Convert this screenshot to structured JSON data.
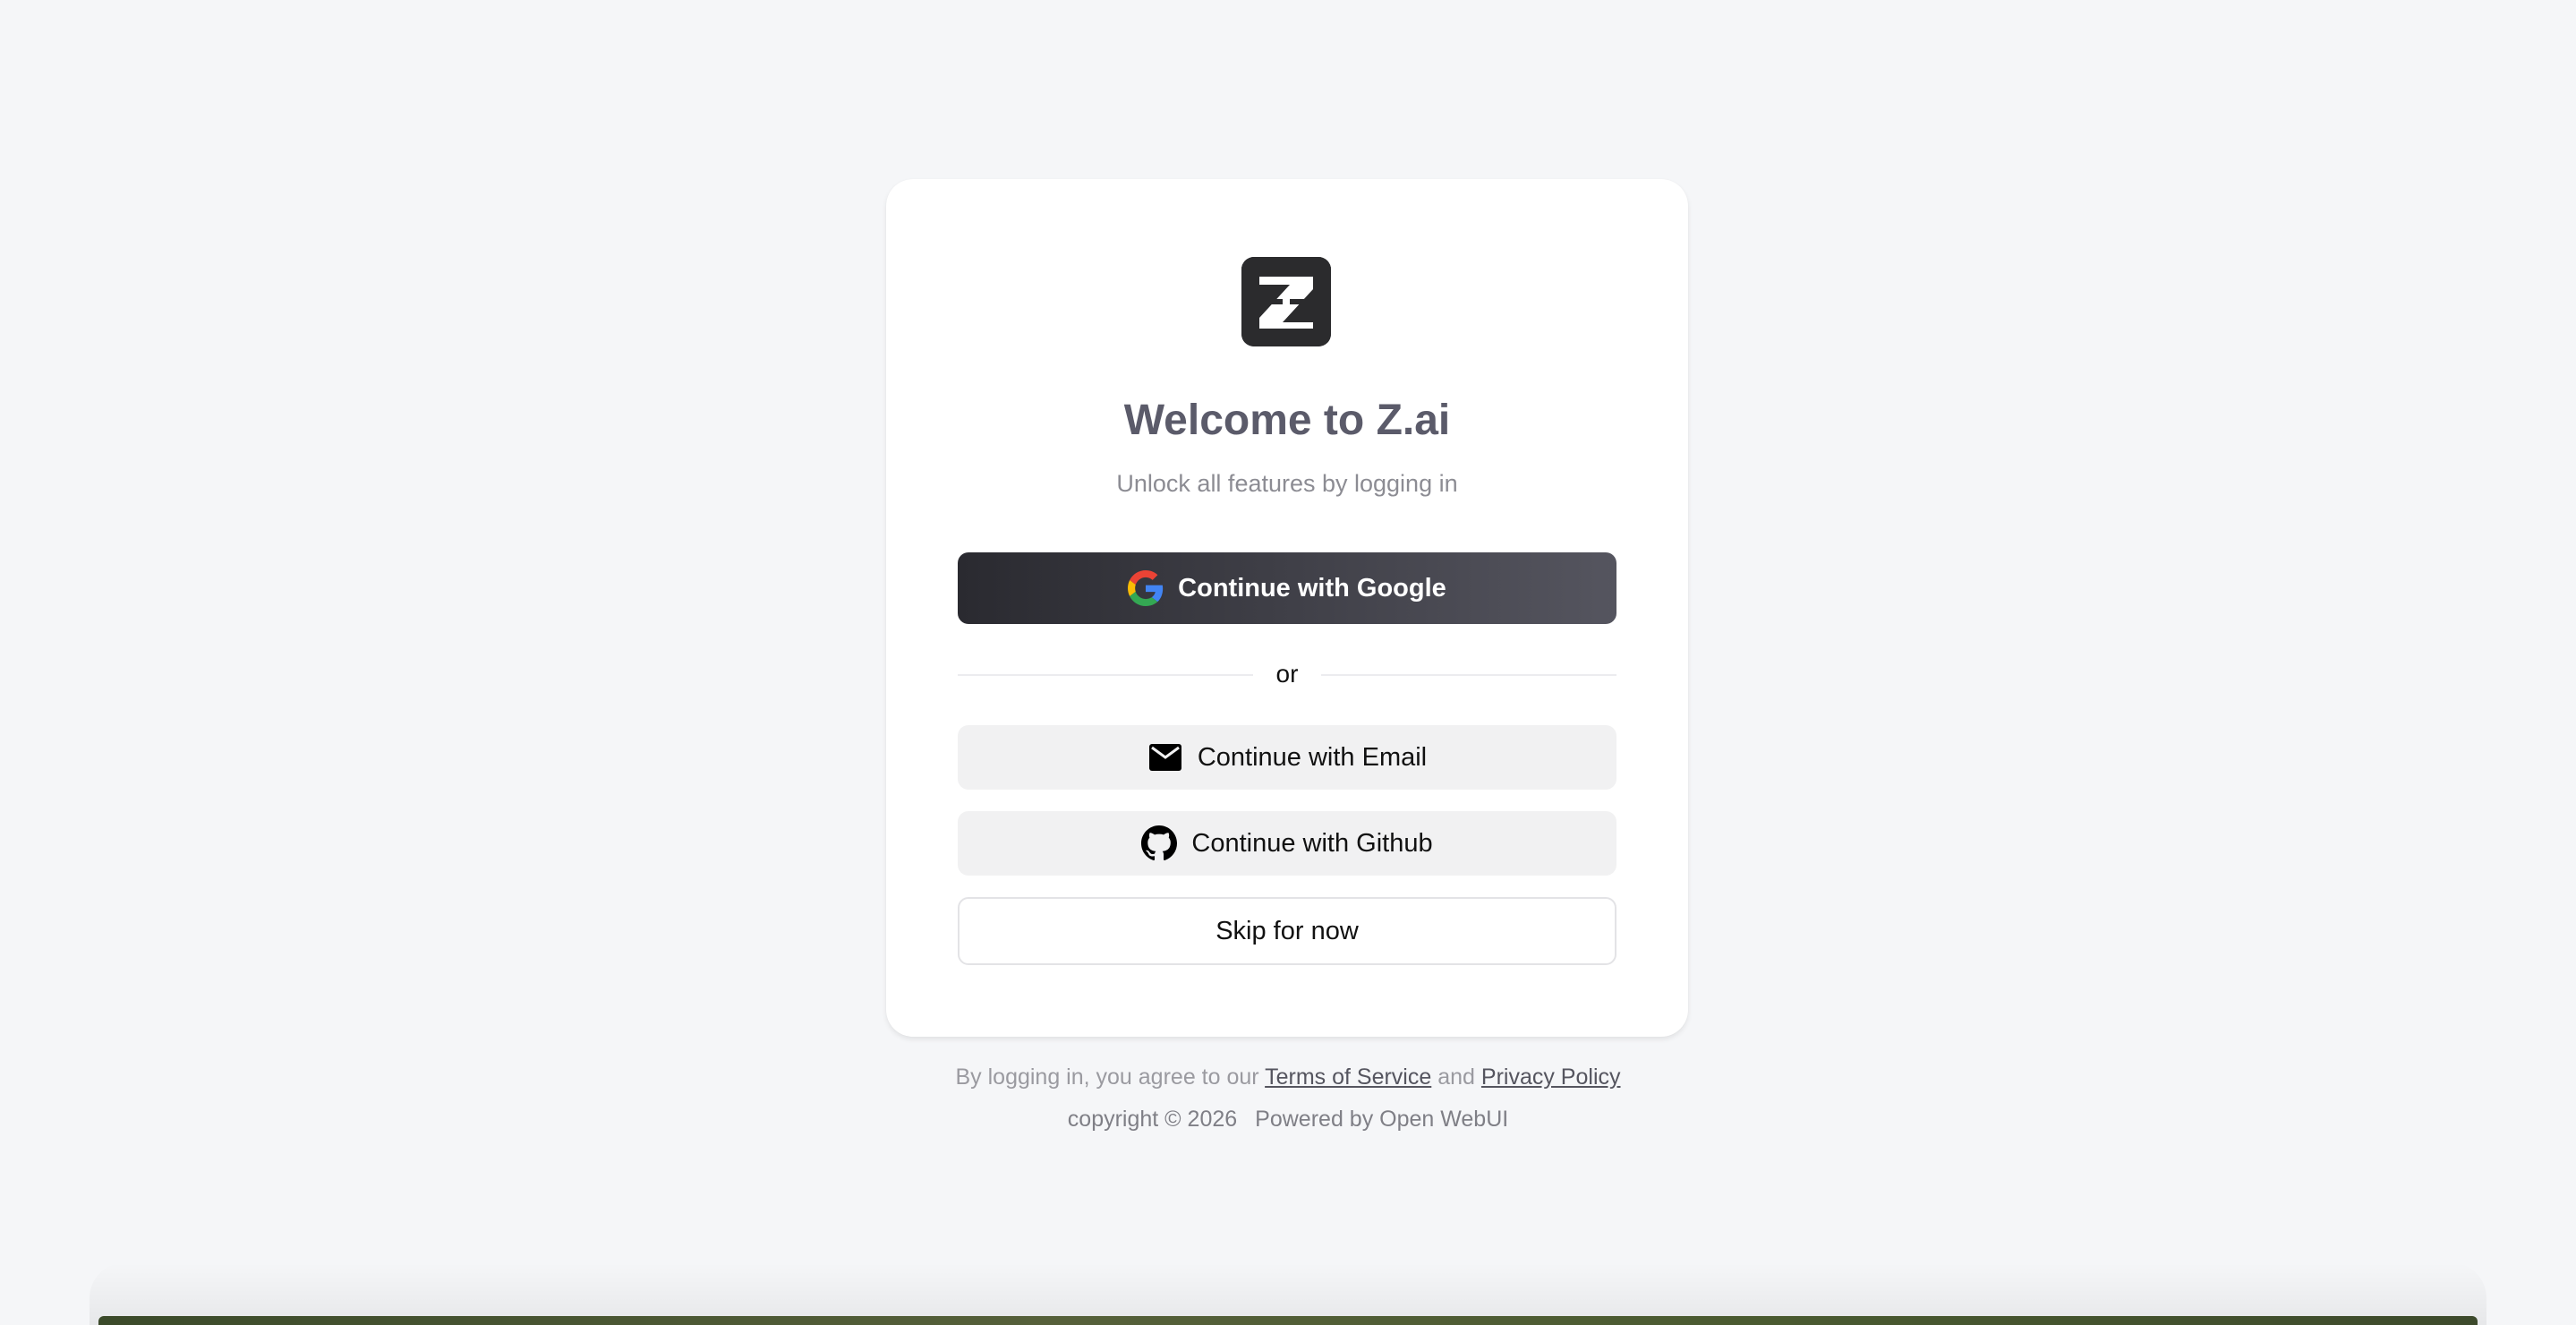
{
  "auth_card": {
    "title": "Welcome to Z.ai",
    "subtitle": "Unlock all features by logging in",
    "google_button": "Continue with Google",
    "divider": "or",
    "email_button": "Continue with Email",
    "github_button": "Continue with Github",
    "skip_button": "Skip for now"
  },
  "footer": {
    "agree_prefix": "By logging in, you agree to our",
    "terms": "Terms of Service",
    "and": "and",
    "privacy": "Privacy Policy",
    "copyright": "copyright © 2026",
    "powered": "Powered by Open WebUI"
  },
  "colors": {
    "background": "#f5f6f8",
    "card": "#ffffff",
    "primary_button": "#2a2a30",
    "secondary_button": "#f1f1f2",
    "title": "#5b5b6a"
  },
  "icons": {
    "logo": "z-logo",
    "google": "google-g-icon",
    "email": "mail-icon",
    "github": "github-icon"
  }
}
